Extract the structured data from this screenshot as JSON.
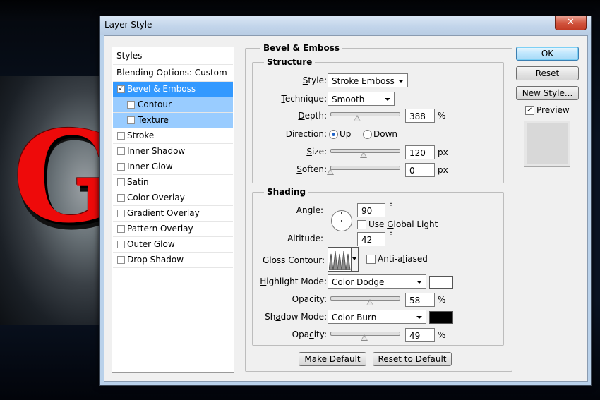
{
  "window": {
    "title": "Layer Style",
    "close_glyph": "✕"
  },
  "background_art": {
    "letter": "G"
  },
  "styles_panel": {
    "header": "Styles",
    "blending_options": "Blending Options: Custom",
    "items": [
      {
        "label": "Bevel & Emboss",
        "checked": true,
        "state": "selected",
        "check_glyph": "✓"
      },
      {
        "label": "Contour",
        "checked": false,
        "state": "sub"
      },
      {
        "label": "Texture",
        "checked": false,
        "state": "sub"
      },
      {
        "label": "Stroke",
        "checked": false
      },
      {
        "label": "Inner Shadow",
        "checked": false
      },
      {
        "label": "Inner Glow",
        "checked": false
      },
      {
        "label": "Satin",
        "checked": false
      },
      {
        "label": "Color Overlay",
        "checked": false
      },
      {
        "label": "Gradient Overlay",
        "checked": false
      },
      {
        "label": "Pattern Overlay",
        "checked": false
      },
      {
        "label": "Outer Glow",
        "checked": false
      },
      {
        "label": "Drop Shadow",
        "checked": false
      }
    ]
  },
  "bevel_emboss": {
    "title": "Bevel & Emboss",
    "structure": {
      "title": "Structure",
      "style": {
        "label_pre": "",
        "label_u": "S",
        "label_post": "tyle:",
        "value": "Stroke Emboss"
      },
      "technique": {
        "label_pre": "",
        "label_u": "T",
        "label_post": "echnique:",
        "value": "Smooth"
      },
      "depth": {
        "label_pre": "",
        "label_u": "D",
        "label_post": "epth:",
        "value": "388",
        "unit": "%",
        "slider_fraction": 0.39
      },
      "direction": {
        "label": "Direction:",
        "up_label": "Up",
        "down_label": "Down",
        "selected": "Up"
      },
      "size": {
        "label_pre": "",
        "label_u": "S",
        "label_post": "ize:",
        "value": "120",
        "unit": "px",
        "slider_fraction": 0.48
      },
      "soften": {
        "label_pre": "",
        "label_u": "S",
        "label_post": "often:",
        "value": "0",
        "unit": "px",
        "slider_fraction": 0.0
      }
    },
    "shading": {
      "title": "Shading",
      "angle": {
        "label": "Angle:",
        "value": "90",
        "unit": "°"
      },
      "use_global_light": {
        "label_pre": "Use ",
        "label_u": "G",
        "label_post": "lobal Light",
        "checked": false
      },
      "altitude": {
        "label": "Altitude:",
        "value": "42",
        "unit": "°"
      },
      "gloss_contour": {
        "label": "Gloss Contour:"
      },
      "anti_aliased": {
        "label_pre": "Anti-a",
        "label_u": "l",
        "label_post": "iased",
        "checked": false
      },
      "highlight_mode": {
        "label_pre": "",
        "label_u": "H",
        "label_post": "ighlight Mode:",
        "value": "Color Dodge",
        "color": "#ffffff"
      },
      "highlight_opacity": {
        "label_pre": "",
        "label_u": "O",
        "label_post": "pacity:",
        "value": "58",
        "unit": "%",
        "slider_fraction": 0.58
      },
      "shadow_mode": {
        "label_pre": "Sh",
        "label_u": "a",
        "label_post": "dow Mode:",
        "value": "Color Burn",
        "color": "#000000"
      },
      "shadow_opacity": {
        "label_pre": "Opa",
        "label_u": "c",
        "label_post": "ity:",
        "value": "49",
        "unit": "%",
        "slider_fraction": 0.49
      }
    },
    "make_default": "Make Default",
    "reset_to_default": "Reset to Default"
  },
  "buttons": {
    "ok": "OK",
    "reset": "Reset",
    "new_style": {
      "label_pre": "",
      "label_u": "N",
      "label_post": "ew Style..."
    },
    "preview": {
      "label_pre": "Pre",
      "label_u": "v",
      "label_post": "iew",
      "checked": true,
      "check_glyph": "✓"
    }
  }
}
